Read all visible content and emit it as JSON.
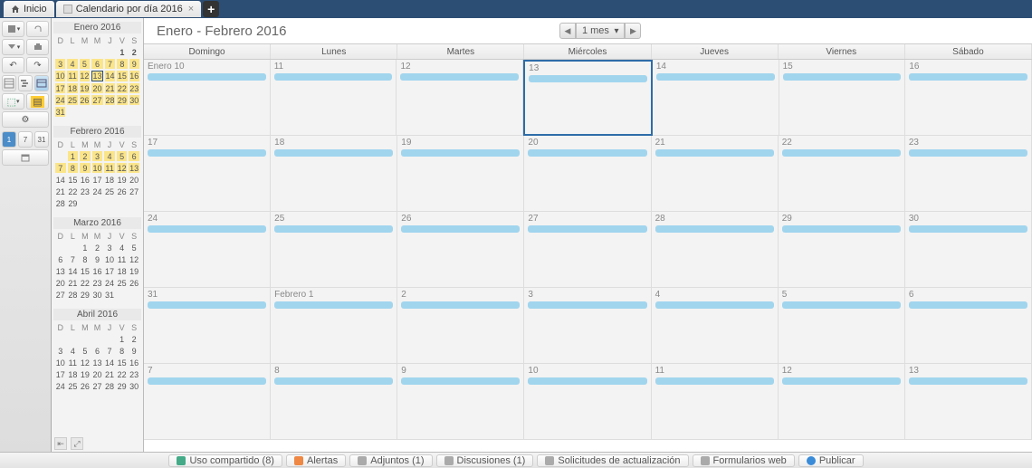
{
  "tabs": {
    "home": "Inicio",
    "cal": "Calendario por día 2016"
  },
  "title": "Enero - Febrero 2016",
  "nav_range": "1 mes",
  "days": [
    "Domingo",
    "Lunes",
    "Martes",
    "Miércoles",
    "Jueves",
    "Viernes",
    "Sábado"
  ],
  "dow": [
    "D",
    "L",
    "M",
    "M",
    "J",
    "V",
    "S"
  ],
  "minicals": [
    {
      "title": "Enero 2016",
      "lead": 5,
      "days": 31,
      "hl_from": 3,
      "hl_to": 31,
      "today": 13,
      "bold": [
        1,
        2
      ]
    },
    {
      "title": "Febrero 2016",
      "lead": 1,
      "days": 29,
      "hl_from": 1,
      "hl_to": 13,
      "today": 0,
      "bold": []
    },
    {
      "title": "Marzo 2016",
      "lead": 2,
      "days": 31,
      "hl_from": 0,
      "hl_to": 0,
      "today": 0,
      "bold": []
    },
    {
      "title": "Abril 2016",
      "lead": 5,
      "days": 30,
      "hl_from": 0,
      "hl_to": 0,
      "today": 0,
      "bold": []
    }
  ],
  "weeks": [
    [
      "Enero 10",
      "11",
      "12",
      "13",
      "14",
      "15",
      "16"
    ],
    [
      "17",
      "18",
      "19",
      "20",
      "21",
      "22",
      "23"
    ],
    [
      "24",
      "25",
      "26",
      "27",
      "28",
      "29",
      "30"
    ],
    [
      "31",
      "Febrero 1",
      "2",
      "3",
      "4",
      "5",
      "6"
    ],
    [
      "7",
      "8",
      "9",
      "10",
      "11",
      "12",
      "13"
    ]
  ],
  "today_cell": [
    0,
    3
  ],
  "bottom": {
    "share": "Uso compartido (8)",
    "alerts": "Alertas",
    "attach": "Adjuntos (1)",
    "disc": "Discusiones (1)",
    "upd": "Solicitudes de actualización",
    "forms": "Formularios web",
    "pub": "Publicar"
  }
}
